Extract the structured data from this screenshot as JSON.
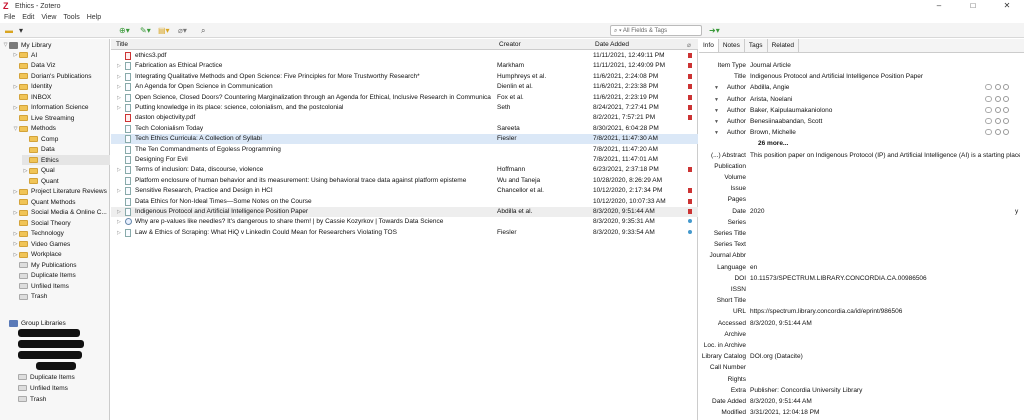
{
  "window": {
    "title": "Ethics - Zotero",
    "logo": "Z",
    "controls": [
      "–",
      "□",
      "✕"
    ]
  },
  "menu": [
    "File",
    "Edit",
    "View",
    "Tools",
    "Help"
  ],
  "toolbar": {
    "search_placeholder": "All Fields & Tags",
    "icons": [
      "new-collection-icon",
      "collection-menu-icon",
      "new-item-icon",
      "add-by-identifier-icon",
      "new-note-icon",
      "add-attachment-icon",
      "advanced-search-icon",
      "sync-icon"
    ]
  },
  "left_panel": {
    "library": "My Library",
    "collections": [
      {
        "label": "AI",
        "indent": 1,
        "twisty": "▷",
        "selected": false
      },
      {
        "label": "Data Viz",
        "indent": 1,
        "twisty": "",
        "selected": false
      },
      {
        "label": "Dorian's Publications",
        "indent": 1,
        "twisty": "",
        "selected": false
      },
      {
        "label": "Identity",
        "indent": 1,
        "twisty": "▷",
        "selected": false
      },
      {
        "label": "INBOX",
        "indent": 1,
        "twisty": "",
        "selected": false
      },
      {
        "label": "Information Science",
        "indent": 1,
        "twisty": "▷",
        "selected": false
      },
      {
        "label": "Live Streaming",
        "indent": 1,
        "twisty": "",
        "selected": false
      },
      {
        "label": "Methods",
        "indent": 1,
        "twisty": "▽",
        "selected": false
      },
      {
        "label": "Comp",
        "indent": 2,
        "twisty": "",
        "selected": false
      },
      {
        "label": "Data",
        "indent": 2,
        "twisty": "",
        "selected": false
      },
      {
        "label": "Ethics",
        "indent": 2,
        "twisty": "",
        "selected": true
      },
      {
        "label": "Qual",
        "indent": 2,
        "twisty": "▷",
        "selected": false
      },
      {
        "label": "Quant",
        "indent": 2,
        "twisty": "",
        "selected": false
      },
      {
        "label": "Project Literature Reviews",
        "indent": 1,
        "twisty": "▷",
        "selected": false
      },
      {
        "label": "Quant Methods",
        "indent": 1,
        "twisty": "",
        "selected": false
      },
      {
        "label": "Social Media & Online C...",
        "indent": 1,
        "twisty": "▷",
        "selected": false
      },
      {
        "label": "Social Theory",
        "indent": 1,
        "twisty": "",
        "selected": false
      },
      {
        "label": "Technology",
        "indent": 1,
        "twisty": "▷",
        "selected": false
      },
      {
        "label": "Video Games",
        "indent": 1,
        "twisty": "▷",
        "selected": false
      },
      {
        "label": "Workplace",
        "indent": 1,
        "twisty": "▷",
        "selected": false
      },
      {
        "label": "My Publications",
        "indent": 1,
        "twisty": "",
        "selected": false
      },
      {
        "label": "Duplicate Items",
        "indent": 1,
        "twisty": "",
        "selected": false
      },
      {
        "label": "Unfiled Items",
        "indent": 1,
        "twisty": "",
        "selected": false
      },
      {
        "label": "Trash",
        "indent": 1,
        "twisty": "",
        "selected": false
      }
    ],
    "group_libraries_label": "Group Libraries",
    "group_sub": [
      "Duplicate Items",
      "Unfiled Items",
      "Trash"
    ]
  },
  "items_table": {
    "headers": {
      "title": "Title",
      "creator": "Creator",
      "date_added": "Date Added"
    },
    "rows": [
      {
        "title": "ethics3.pdf",
        "creator": "",
        "date": "11/11/2021, 12:49:11 PM",
        "icon": "pdf",
        "twisty": "",
        "att": "pdf",
        "sel": false
      },
      {
        "title": "Fabrication as Ethical Practice",
        "creator": "Markham",
        "date": "11/11/2021, 12:49:09 PM",
        "icon": "doc",
        "twisty": "▷",
        "att": "pdf",
        "sel": false
      },
      {
        "title": "Integrating Qualitative Methods and Open Science: Five Principles for More Trustworthy Research*",
        "creator": "Humphreys et al.",
        "date": "11/6/2021, 2:24:08 PM",
        "icon": "doc",
        "twisty": "▷",
        "att": "pdf",
        "sel": false
      },
      {
        "title": "An Agenda for Open Science in Communication",
        "creator": "Dienlin et al.",
        "date": "11/6/2021, 2:23:38 PM",
        "icon": "doc",
        "twisty": "▷",
        "att": "pdf",
        "sel": false
      },
      {
        "title": "Open Science, Closed Doors? Countering Marginalization through an Agenda for Ethical, Inclusive Research in Communicati...",
        "creator": "Fox et al.",
        "date": "11/6/2021, 2:23:19 PM",
        "icon": "doc",
        "twisty": "▷",
        "att": "pdf",
        "sel": false
      },
      {
        "title": "Putting knowledge in its place: science, colonialism, and the postcolonial",
        "creator": "Seth",
        "date": "8/24/2021, 7:27:41 PM",
        "icon": "doc",
        "twisty": "▷",
        "att": "pdf",
        "sel": false
      },
      {
        "title": "daston objectivity.pdf",
        "creator": "",
        "date": "8/2/2021, 7:57:21 PM",
        "icon": "pdf",
        "twisty": "",
        "att": "pdf",
        "sel": false
      },
      {
        "title": "Tech Colonialism Today",
        "creator": "Sareeta",
        "date": "8/30/2021, 6:04:28 PM",
        "icon": "doc",
        "twisty": "",
        "att": "",
        "sel": false
      },
      {
        "title": "Tech Ethics Curricula: A Collection of Syllabi",
        "creator": "Fiesler",
        "date": "7/8/2021, 11:47:30 AM",
        "icon": "doc",
        "twisty": "",
        "att": "",
        "sel": true
      },
      {
        "title": "The Ten Commandments of Egoless Programming",
        "creator": "",
        "date": "7/8/2021, 11:47:20 AM",
        "icon": "doc",
        "twisty": "",
        "att": "",
        "sel": false
      },
      {
        "title": "Designing For Evil",
        "creator": "",
        "date": "7/8/2021, 11:47:01 AM",
        "icon": "doc",
        "twisty": "",
        "att": "",
        "sel": false
      },
      {
        "title": "Terms of inclusion: Data, discourse, violence",
        "creator": "Hoffmann",
        "date": "6/23/2021, 2:37:18 PM",
        "icon": "doc",
        "twisty": "▷",
        "att": "pdf",
        "sel": false
      },
      {
        "title": "Platform enclosure of human behavior and its measurement: Using behavioral trace data against platform episteme",
        "creator": "Wu and Taneja",
        "date": "10/28/2020, 8:26:29 AM",
        "icon": "doc",
        "twisty": "",
        "att": "",
        "sel": false
      },
      {
        "title": "Sensitive Research, Practice and Design in HCI",
        "creator": "Chancellor et al.",
        "date": "10/12/2020, 2:17:34 PM",
        "icon": "doc",
        "twisty": "▷",
        "att": "pdf",
        "sel": false
      },
      {
        "title": "Data Ethics for Non-Ideal Times—Some Notes on the Course",
        "creator": "",
        "date": "10/12/2020, 10:07:33 AM",
        "icon": "doc",
        "twisty": "",
        "att": "pdf",
        "sel": false
      },
      {
        "title": "Indigenous Protocol and Artificial Intelligence Position Paper",
        "creator": "Abdilla et al.",
        "date": "8/3/2020, 9:51:44 AM",
        "icon": "doc",
        "twisty": "▷",
        "att": "pdf",
        "sel": false,
        "hl": true
      },
      {
        "title": "Why are p-values like needles? It's dangerous to share them! | by Cassie Kozyrkov | Towards Data Science",
        "creator": "",
        "date": "8/3/2020, 9:35:31 AM",
        "icon": "web",
        "twisty": "▷",
        "att": "dot",
        "sel": false
      },
      {
        "title": "Law & Ethics of Scraping: What HiQ v LinkedIn Could Mean for Researchers Violating TOS",
        "creator": "Fiesler",
        "date": "8/3/2020, 9:33:54 AM",
        "icon": "doc",
        "twisty": "▷",
        "att": "dot",
        "sel": false
      }
    ]
  },
  "item_pane": {
    "tabs": [
      "Info",
      "Notes",
      "Tags",
      "Related"
    ],
    "fields": [
      {
        "label": "Item Type",
        "value": "Journal Article"
      },
      {
        "label": "Title",
        "value": "Indigenous Protocol and Artificial Intelligence Position Paper"
      },
      {
        "label": "Author",
        "value": "Abdilla, Angie",
        "author": true
      },
      {
        "label": "Author",
        "value": "Arista, Noelani",
        "author": true
      },
      {
        "label": "Author",
        "value": "Baker, Kaipulaumakaniolono",
        "author": true
      },
      {
        "label": "Author",
        "value": "Benesiinaabandan, Scott",
        "author": true
      },
      {
        "label": "Author",
        "value": "Brown, Michelle",
        "author": true
      },
      {
        "label": "",
        "value": "26 more...",
        "bold": true
      },
      {
        "label": "(...) Abstract",
        "value": "This position paper on Indigenous Protocol (IP) and Artificial Intelligence (AI) is a starting place..."
      },
      {
        "label": "Publication",
        "value": ""
      },
      {
        "label": "Volume",
        "value": ""
      },
      {
        "label": "Issue",
        "value": ""
      },
      {
        "label": "Pages",
        "value": ""
      },
      {
        "label": "Date",
        "value": "2020",
        "suffix": "y"
      },
      {
        "label": "Series",
        "value": ""
      },
      {
        "label": "Series Title",
        "value": ""
      },
      {
        "label": "Series Text",
        "value": ""
      },
      {
        "label": "Journal Abbr",
        "value": ""
      },
      {
        "label": "Language",
        "value": "en"
      },
      {
        "label": "DOI",
        "value": "10.11573/SPECTRUM.LIBRARY.CONCORDIA.CA.00986506"
      },
      {
        "label": "ISSN",
        "value": ""
      },
      {
        "label": "Short Title",
        "value": ""
      },
      {
        "label": "URL",
        "value": "https://spectrum.library.concordia.ca/id/eprint/986506"
      },
      {
        "label": "Accessed",
        "value": "8/3/2020, 9:51:44 AM"
      },
      {
        "label": "Archive",
        "value": ""
      },
      {
        "label": "Loc. in Archive",
        "value": ""
      },
      {
        "label": "Library Catalog",
        "value": "DOI.org (Datacite)"
      },
      {
        "label": "Call Number",
        "value": ""
      },
      {
        "label": "Rights",
        "value": ""
      },
      {
        "label": "Extra",
        "value": "Publisher: Concordia University Library"
      },
      {
        "label": "Date Added",
        "value": "8/3/2020, 9:51:44 AM"
      },
      {
        "label": "Modified",
        "value": "3/31/2021, 12:04:18 PM"
      }
    ]
  }
}
